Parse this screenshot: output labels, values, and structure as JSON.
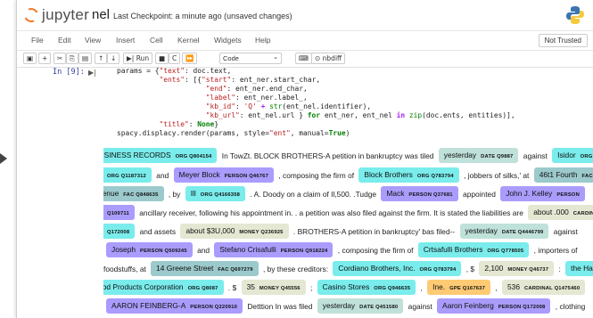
{
  "header": {
    "logo_text": "jupyter",
    "notebook_name": "nel",
    "checkpoint": "Last Checkpoint: a minute ago  (unsaved changes)"
  },
  "menubar": {
    "items": [
      "File",
      "Edit",
      "View",
      "Insert",
      "Cell",
      "Kernel",
      "Widgets",
      "Help"
    ],
    "trusted": "Not Trusted"
  },
  "toolbar": {
    "run_label": "Run",
    "cell_type": "Code",
    "nbdiff_label": "nbdiff"
  },
  "cell": {
    "prompt": "In [9]:"
  },
  "output": {
    "lines": [
      [
        {
          "e": "BUSINESS RECORDS",
          "l": "ORG",
          "id": "Q804154"
        },
        {
          "t": "In TowZt. BLOCK BROTHERS-A petition in bankruptcy was tiled"
        },
        {
          "e": "yesterday",
          "l": "DATE",
          "id": "Q9887"
        },
        {
          "t": "against"
        },
        {
          "e": "Isidor",
          "l": "ORG",
          "id": ""
        }
      ],
      [
        {
          "e": "",
          "l": "ORG",
          "id": "Q1187312"
        },
        {
          "t": "and"
        },
        {
          "e": "Meyer Block",
          "l": "PERSON",
          "id": "Q46767"
        },
        {
          "t": ", composing the firm of"
        },
        {
          "e": "Block Brothers",
          "l": "ORG",
          "id": "Q783794"
        },
        {
          "t": ", jobbers of silks,' at"
        },
        {
          "e": "46t1 Fourth",
          "l": "FAC",
          "id": ""
        }
      ],
      [
        {
          "e": "Avenue",
          "l": "FAC",
          "id": "Q848635"
        },
        {
          "t": ", by"
        },
        {
          "e": "Ill",
          "l": "ORG",
          "id": "Q4166358"
        },
        {
          "t": ". A. Doody on a claim of Il,500. .Tudge"
        },
        {
          "e": "Mack",
          "l": "PERSON",
          "id": "Q37681"
        },
        {
          "t": "appointed"
        },
        {
          "e": "John J. Kelley",
          "l": "PERSON",
          "id": ""
        }
      ],
      [
        {
          "e": "",
          "l": "",
          "id": "Q109711"
        },
        {
          "t": "ancillary receiver, following his appointment in. . a petition was also filed against the firm. It is stated the liabilities are"
        },
        {
          "e": "about .000",
          "l": "CARDINA",
          "id": ""
        }
      ],
      [
        {
          "e": "",
          "l": "",
          "id": "Q172008"
        },
        {
          "t": "and assets"
        },
        {
          "e": "about $3U,000",
          "l": "MONEY",
          "id": "Q236925"
        },
        {
          "t": ". BROTHERS-A petition in bankruptcy' bas filed--"
        },
        {
          "e": "yesterday",
          "l": "DATE",
          "id": "Q4446799"
        },
        {
          "t": "against"
        }
      ],
      [
        {
          "e": "Joseph",
          "l": "PERSON",
          "id": "Q509245"
        },
        {
          "t": "and"
        },
        {
          "e": "Stefano Crisafulli",
          "l": "PERSON",
          "id": "Q918224"
        },
        {
          "t": ", composing the firm of"
        },
        {
          "e": "Crtsafulli Brothers",
          "l": "ORG",
          "id": "Q778505"
        },
        {
          "t": ", importers of"
        }
      ],
      [
        {
          "t": "foodstuffs, at"
        },
        {
          "e": "14 Greene Street",
          "l": "FAC",
          "id": "Q697279"
        },
        {
          "t": ", by these creditors:"
        },
        {
          "e": "Cordiano Brothers, Inc.",
          "l": "ORG",
          "id": "Q783794"
        },
        {
          "t": ", $"
        },
        {
          "e": "2,100",
          "l": "MONEY",
          "id": "Q46737"
        },
        {
          "t": ":"
        },
        {
          "e": "the Haud",
          "l": "ORG",
          "id": ""
        }
      ],
      [
        {
          "e": "Food Products Corporation",
          "l": "ORG",
          "id": "Q8087"
        },
        {
          "t": ". $"
        },
        {
          "e": "35",
          "l": "MONEY",
          "id": "Q45556"
        },
        {
          "t": ";"
        },
        {
          "e": "Casino Stores",
          "l": "ORG",
          "id": "Q946635"
        },
        {
          "t": ","
        },
        {
          "e": "Ine.",
          "l": "GPE",
          "id": "Q167637"
        },
        {
          "t": ","
        },
        {
          "e": "536",
          "l": "CARDINAL",
          "id": "Q1475460"
        }
      ],
      [
        {
          "e": "AARON FEINBERG-A",
          "l": "PERSON",
          "id": "Q220910"
        },
        {
          "t": "Detttion In was filed"
        },
        {
          "e": "yesterday",
          "l": "DATE",
          "id": "Q451580"
        },
        {
          "t": "against"
        },
        {
          "e": "Aaron Feinberg",
          "l": "PERSON",
          "id": "Q172008"
        },
        {
          "t": ", clothing"
        }
      ]
    ]
  },
  "colors": {
    "ORG": "#7aecec",
    "PERSON": "#aa9cfc",
    "DATE": "#bfe1d9",
    "FAC": "#9cc9cc",
    "MONEY": "#e4e7d2",
    "GPE": "#feca74",
    "CARDINAL": "#e4e7d2",
    "accent": "#f37726"
  }
}
